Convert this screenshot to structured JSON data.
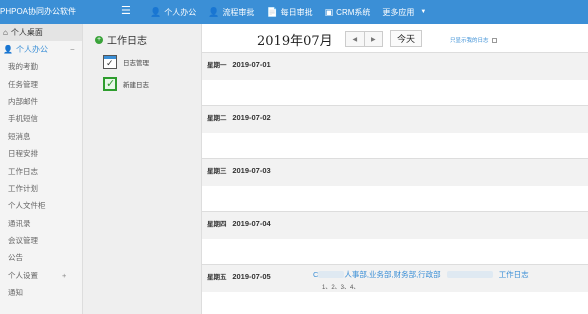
{
  "topbar": {
    "brand": "PHPOA协同办公软件",
    "menu_icon": "menu-icon",
    "nav": [
      {
        "label": "个人办公",
        "icon": "user-icon"
      },
      {
        "label": "流程审批",
        "icon": "user-icon"
      },
      {
        "label": "每日审批",
        "icon": "document-icon"
      },
      {
        "label": "CRM系统",
        "icon": "chart-icon"
      },
      {
        "label": "更多应用",
        "icon": "chevron-down-icon"
      }
    ]
  },
  "sidebar": {
    "home": "个人桌面",
    "group": "个人办公",
    "items": [
      "我的考勤",
      "任务管理",
      "内部邮件",
      "手机短信",
      "短消息",
      "日程安排",
      "工作日志",
      "工作计划",
      "个人文件柜",
      "通讯录",
      "会议管理",
      "公告",
      "个人设置",
      "通知"
    ]
  },
  "subpanel": {
    "title": "工作日志",
    "items": [
      "日志管理",
      "新建日志"
    ]
  },
  "calendar": {
    "current_month": "2019年07月",
    "today_label": "今天",
    "prev_label": "◀",
    "next_label": "▶",
    "only_mine_label": "只显示我的日志",
    "days": [
      {
        "weekday": "星期一",
        "date": "2019-07-01"
      },
      {
        "weekday": "星期二",
        "date": "2019-07-02"
      },
      {
        "weekday": "星期三",
        "date": "2019-07-03"
      },
      {
        "weekday": "星期四",
        "date": "2019-07-04"
      },
      {
        "weekday": "星期五",
        "date": "2019-07-05",
        "entry_prefix": "C",
        "entry_depts": "人事部,业务部,财务部,行政部",
        "entry_title": "工作日志",
        "entry_sub": "1、2、3、4、"
      }
    ]
  },
  "colors": {
    "accent": "#3b8fd6",
    "check_green": "#2e9d2e"
  }
}
